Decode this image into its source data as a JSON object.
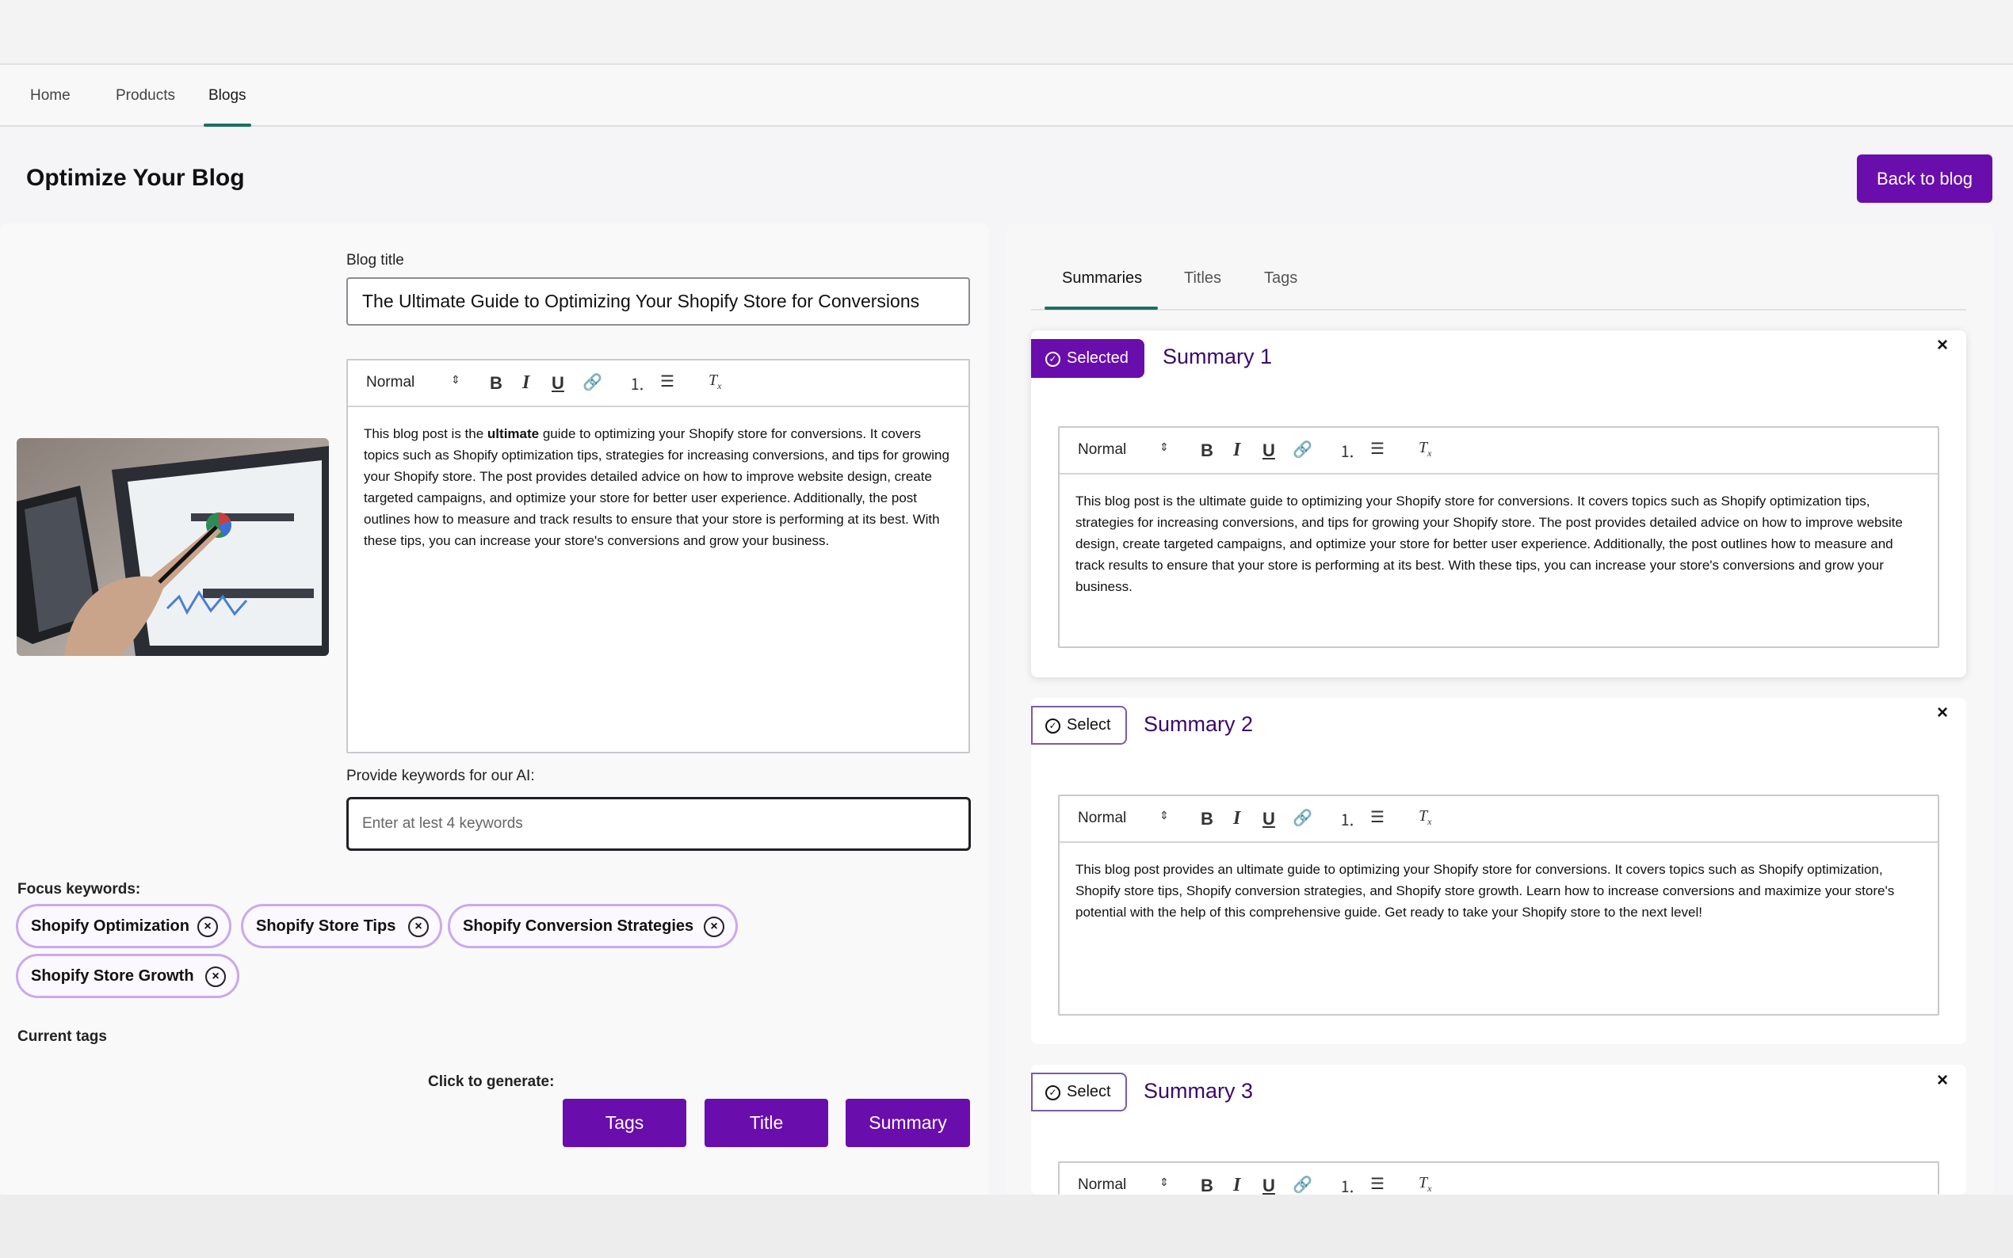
{
  "nav": {
    "items": [
      {
        "label": "Home",
        "active": false
      },
      {
        "label": "Products",
        "active": false
      },
      {
        "label": "Blogs",
        "active": true
      }
    ]
  },
  "header": {
    "title": "Optimize Your Blog",
    "back_button": "Back to blog"
  },
  "left": {
    "image_icon": "analytics-tablet-image",
    "blog_title_label": "Blog title",
    "blog_title_value": "The Ultimate Guide to Optimizing Your Shopify Store for Conversions",
    "editor": {
      "format": "Normal",
      "content_before": "This blog post is the ",
      "content_bold": "ultimate",
      "content_after": " guide to optimizing your Shopify store for conversions. It covers topics such as Shopify optimization tips, strategies for increasing conversions, and tips for growing your Shopify store. The post provides detailed advice on how to improve website design, create targeted campaigns, and optimize your store for better user experience. Additionally, the post outlines how to measure and track results to ensure that your store is performing at its best. With these tips, you can increase your store's conversions and grow your business."
    },
    "keywords_label": "Provide keywords for our AI:",
    "keywords_placeholder": "Enter at lest 4 keywords",
    "focus_label": "Focus keywords:",
    "focus_keywords": [
      "Shopify Optimization",
      "Shopify Store Tips",
      "Shopify Conversion Strategies",
      "Shopify Store Growth"
    ],
    "current_tags_label": "Current tags",
    "generate_label": "Click to generate:",
    "generate_buttons": [
      "Tags",
      "Title",
      "Summary"
    ]
  },
  "right": {
    "tabs": [
      {
        "label": "Summaries",
        "active": true
      },
      {
        "label": "Titles",
        "active": false
      },
      {
        "label": "Tags",
        "active": false
      }
    ],
    "summaries": [
      {
        "select_label": "Selected",
        "selected": true,
        "title": "Summary 1",
        "format": "Normal",
        "content": "This blog post is the ultimate guide to optimizing your Shopify store for conversions. It covers topics such as Shopify optimization tips, strategies for increasing conversions, and tips for growing your Shopify store. The post provides detailed advice on how to improve website design, create targeted campaigns, and optimize your store for better user experience. Additionally, the post outlines how to measure and track results to ensure that your store is performing at its best. With these tips, you can increase your store's conversions and grow your business."
      },
      {
        "select_label": "Select",
        "selected": false,
        "title": "Summary 2",
        "format": "Normal",
        "content": "This blog post provides an ultimate guide to optimizing your Shopify store for conversions. It covers topics such as Shopify optimization, Shopify store tips, Shopify conversion strategies, and Shopify store growth. Learn how to increase conversions and maximize your store's potential with the help of this comprehensive guide. Get ready to take your Shopify store to the next level!"
      },
      {
        "select_label": "Select",
        "selected": false,
        "title": "Summary 3",
        "format": "Normal",
        "content": ""
      }
    ]
  },
  "colors": {
    "accent": "#6a0dad",
    "tab_underline": "#1d6f5e",
    "chip_border": "#c9a9ef"
  }
}
